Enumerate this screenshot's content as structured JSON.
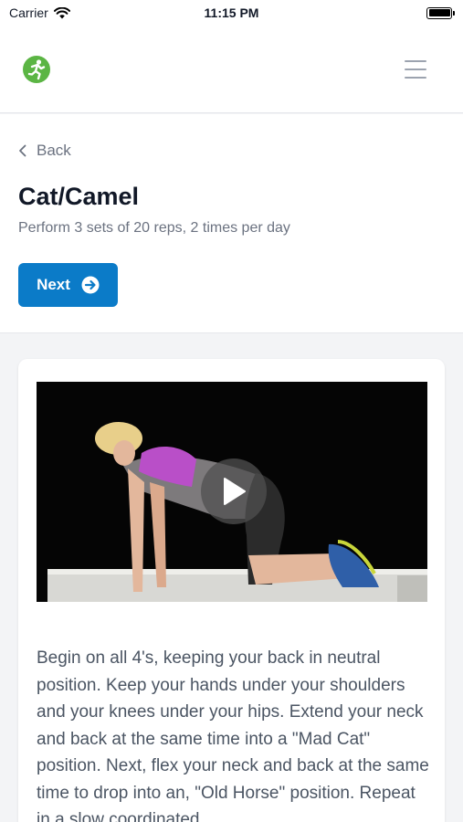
{
  "status_bar": {
    "carrier": "Carrier",
    "time": "11:15 PM"
  },
  "header": {
    "logo_icon": "runner-logo-icon",
    "menu_icon": "hamburger-menu-icon"
  },
  "nav": {
    "back_label": "Back"
  },
  "exercise": {
    "title": "Cat/Camel",
    "subtitle": "Perform 3 sets of 20 reps, 2 times per day",
    "next_label": "Next",
    "description": "Begin on all 4's, keeping your back in neutral position. Keep your hands under your shoulders and your knees under your hips. Extend your neck and back at the same time into a \"Mad Cat\" position. Next, flex your neck and back at the same time to drop into an, \"Old Horse\" position. Repeat in a slow coordinated"
  },
  "colors": {
    "accent": "#0b7bc8",
    "logo_green": "#5bb544",
    "muted_text": "#6b7280"
  }
}
